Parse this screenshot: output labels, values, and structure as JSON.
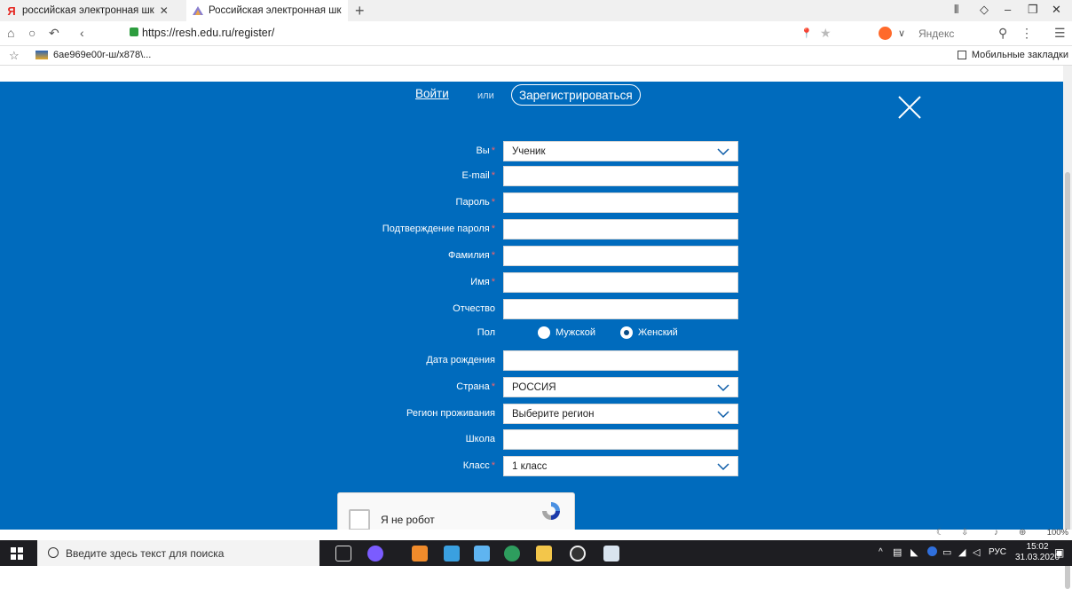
{
  "browser": {
    "tabs": [
      {
        "label": "российская электронная шк",
        "favicon": "yandex-icon"
      },
      {
        "label": "Российская электронная шк",
        "favicon": "resh-icon"
      }
    ],
    "new_tab": "+",
    "url": "https://resh.edu.ru/register/",
    "search_engine": "Яндекс",
    "bookmark": "6ae969e00r-ш/x878\\...",
    "mobile_bookmarks": "Мобильные закладки",
    "zoom": "100%"
  },
  "auth": {
    "login": "Войти",
    "or": "или",
    "register": "Зарегистрироваться"
  },
  "form": {
    "role": {
      "label": "Вы",
      "value": "Ученик"
    },
    "email": {
      "label": "E-mail"
    },
    "password": {
      "label": "Пароль"
    },
    "password_confirm": {
      "label": "Подтверждение пароля"
    },
    "surname": {
      "label": "Фамилия"
    },
    "name": {
      "label": "Имя"
    },
    "patronymic": {
      "label": "Отчество"
    },
    "gender": {
      "label": "Пол",
      "male": "Мужской",
      "female": "Женский"
    },
    "birthdate": {
      "label": "Дата рождения"
    },
    "country": {
      "label": "Страна",
      "value": "РОССИЯ"
    },
    "region": {
      "label": "Регион проживания",
      "value": "Выберите регион"
    },
    "school": {
      "label": "Школа"
    },
    "grade": {
      "label": "Класс",
      "value": "1 класс"
    },
    "captcha": "Я не робот"
  },
  "taskbar": {
    "search_placeholder": "Введите здесь текст для поиска",
    "lang": "РУС",
    "time": "15:02",
    "date": "31.03.2020"
  },
  "colors": {
    "page_bg": "#006bbd",
    "required": "#f2626b"
  }
}
